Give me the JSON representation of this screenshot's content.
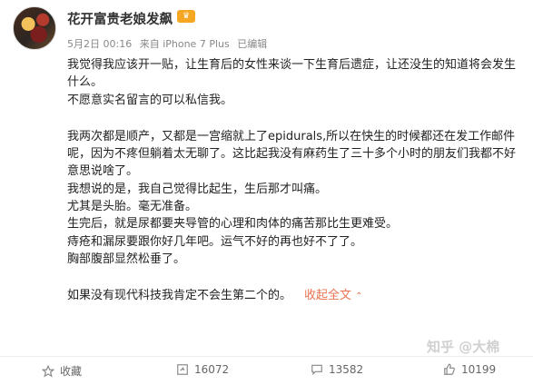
{
  "post": {
    "author": "花开富贵老娘发飙",
    "vip_badge": "♛",
    "timestamp": "5月2日 00:16",
    "source": "来自 iPhone 7 Plus",
    "edited": "已编辑",
    "paragraphs": [
      "我觉得我应该开一贴，让生育后的女性来谈一下生育后遗症，让还没生的知道将会发生什么。",
      "不愿意实名留言的可以私信我。",
      "",
      "我两次都是顺产，又都是一宫缩就上了epidurals,所以在快生的时候都还在发工作邮件呢，因为不疼但躺着太无聊了。这比起我没有麻药生了三十多个小时的朋友们我都不好意思说啥了。",
      "我想说的是，我自己觉得比起生，生后那才叫痛。",
      "尤其是头胎。毫无准备。",
      "生完后，就是尿都要夹导管的心理和肉体的痛苦那比生更难受。",
      "痔疮和漏尿要跟你好几年吧。运气不好的再也好不了了。",
      "胸部腹部显然松垂了。",
      ""
    ],
    "last_line": "如果没有现代科技我肯定不会生第二个的。",
    "expand_label": "收起全文",
    "expand_caret": "⌃"
  },
  "actions": {
    "collect_label": "收藏",
    "repost_count": "16072",
    "comment_count": "13582",
    "like_count": "10199"
  },
  "watermark": "知乎 @大棉"
}
